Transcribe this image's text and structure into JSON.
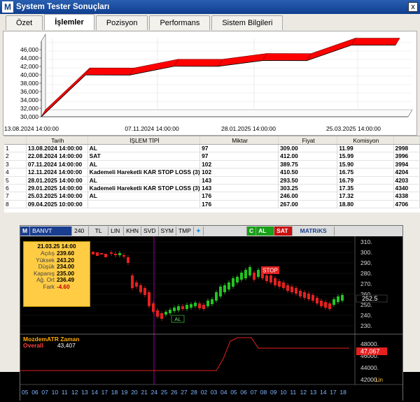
{
  "window": {
    "title": "System Tester Sonuçları",
    "logo": "M",
    "close": "x"
  },
  "tabs": [
    {
      "label": "Özet"
    },
    {
      "label": "İşlemler",
      "active": true
    },
    {
      "label": "Pozisyon"
    },
    {
      "label": "Performans"
    },
    {
      "label": "Sistem Bilgileri"
    }
  ],
  "chart_data": {
    "type": "area",
    "x_tick_labels": [
      "13.08.2024 14:00:00",
      "07.11.2024 14:00:00",
      "28.01.2025 14:00:00",
      "25.03.2025 14:00:00"
    ],
    "y_ticks": [
      30000,
      32000,
      34000,
      36000,
      38000,
      40000,
      42000,
      44000,
      46000
    ],
    "y_tick_labels": [
      "30,000",
      "32,000",
      "34,000",
      "36,000",
      "38,000",
      "40,000",
      "42,000",
      "44,000",
      "46,000"
    ],
    "ylim": [
      30000,
      47000
    ],
    "x": [
      0,
      1,
      2,
      3,
      4,
      5,
      6,
      7,
      8
    ],
    "values": [
      29980,
      39964,
      39946,
      42040,
      42034,
      43408,
      43389,
      47066,
      47066
    ],
    "color": "#ff0000"
  },
  "table": {
    "headers": [
      "",
      "Tarih",
      "İŞLEM TİPİ",
      "Miktar",
      "Fiyat",
      "Komisyon",
      ""
    ],
    "rows": [
      [
        "1",
        "13.08.2024 14:00:00",
        "AL",
        "97",
        "309.00",
        "11.99",
        "2998"
      ],
      [
        "2",
        "22.08.2024 14:00:00",
        "SAT",
        "97",
        "412.00",
        "15.99",
        "3996"
      ],
      [
        "3",
        "07.11.2024 14:00:00",
        "AL",
        "102",
        "389.75",
        "15.90",
        "3994"
      ],
      [
        "4",
        "12.11.2024 14:00:00",
        "Kademeli Hareketli KAR STOP LOSS (3)",
        "102",
        "410.50",
        "16.75",
        "4204"
      ],
      [
        "5",
        "28.01.2025 14:00:00",
        "AL",
        "143",
        "293.50",
        "16.79",
        "4203"
      ],
      [
        "6",
        "29.01.2025 14:00:00",
        "Kademeli Hareketli KAR STOP LOSS (3)",
        "143",
        "303.25",
        "17.35",
        "4340"
      ],
      [
        "7",
        "25.03.2025 14:00:00",
        "AL",
        "176",
        "246.00",
        "17.32",
        "4338"
      ],
      [
        "8",
        "09.04.2025 10:00:00",
        "",
        "176",
        "267.00",
        "18.80",
        "4706"
      ]
    ]
  },
  "matriks": {
    "toolbar": [
      "M",
      "BANVT",
      "240",
      "TL",
      "LIN",
      "KHN",
      "SVD",
      "SYM",
      "TMP",
      "C",
      "AL",
      "SAT",
      "MATRiKS"
    ],
    "info": {
      "date": "21.03.25 14:00",
      "rows": [
        {
          "k": "Açılış",
          "v": "239.60"
        },
        {
          "k": "Yüksek",
          "v": "243.20"
        },
        {
          "k": "Düşük",
          "v": "234.00"
        },
        {
          "k": "Kapanış",
          "v": "235.00"
        },
        {
          "k": "Ağ. Ort",
          "v": "236.49"
        },
        {
          "k": "Fark",
          "v": "-4.60"
        }
      ]
    },
    "price_axis": [
      "310.",
      "300.",
      "290.",
      "280.",
      "270.",
      "260.",
      "250.",
      "240.",
      "230."
    ],
    "last_price": "252.5",
    "stop_label": "STOP",
    "al_label": "AL",
    "indicator": {
      "name": "MozdemATR  Zaman",
      "overall_label": "Overall",
      "overall_value": "43,407",
      "axis": [
        "48000.",
        "46000.",
        "44000.",
        "42000."
      ],
      "last_value": "47,067",
      "scale": "Lin"
    },
    "dates": [
      "05",
      "06",
      "07",
      "10",
      "11",
      "12",
      "13",
      "14",
      "17",
      "18",
      "19",
      "20",
      "21",
      "24",
      "25",
      "26",
      "27",
      "28",
      "02",
      "03",
      "04",
      "05",
      "06",
      "07",
      "08",
      "09",
      "10",
      "11",
      "12",
      "13",
      "14",
      "17",
      "18"
    ],
    "colors": {
      "up": "#22c322",
      "down": "#e52020",
      "stop_marker": "#e52020",
      "al_marker": "#2a8a2a"
    }
  }
}
